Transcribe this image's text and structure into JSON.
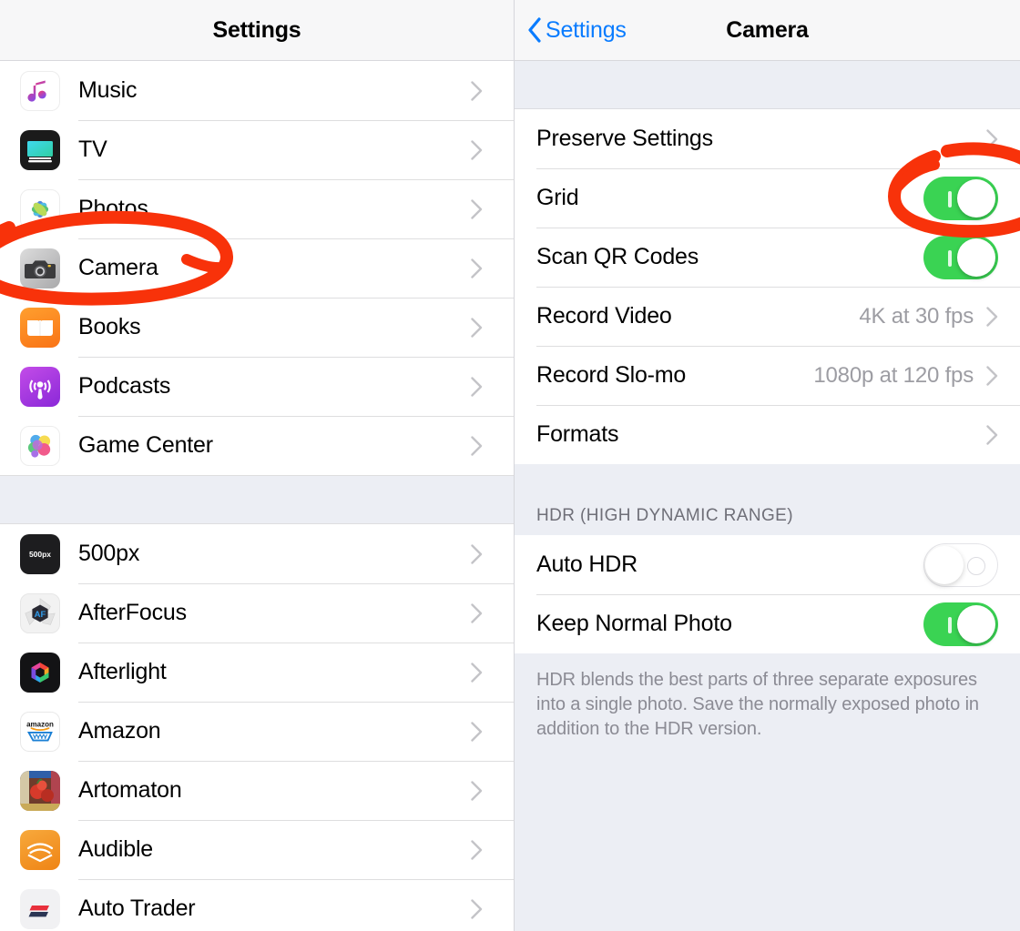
{
  "left": {
    "navbar": {
      "title": "Settings"
    },
    "groups": [
      {
        "items": [
          {
            "label": "Music",
            "icon": "music-app-icon"
          },
          {
            "label": "TV",
            "icon": "tv-app-icon"
          },
          {
            "label": "Photos",
            "icon": "photos-app-icon"
          },
          {
            "label": "Camera",
            "icon": "camera-app-icon"
          },
          {
            "label": "Books",
            "icon": "books-app-icon"
          },
          {
            "label": "Podcasts",
            "icon": "podcasts-app-icon"
          },
          {
            "label": "Game Center",
            "icon": "game-center-app-icon"
          }
        ]
      },
      {
        "items": [
          {
            "label": "500px",
            "icon": "500px-app-icon"
          },
          {
            "label": "AfterFocus",
            "icon": "afterfocus-app-icon"
          },
          {
            "label": "Afterlight",
            "icon": "afterlight-app-icon"
          },
          {
            "label": "Amazon",
            "icon": "amazon-app-icon"
          },
          {
            "label": "Artomaton",
            "icon": "artomaton-app-icon"
          },
          {
            "label": "Audible",
            "icon": "audible-app-icon"
          },
          {
            "label": "Auto Trader",
            "icon": "auto-trader-app-icon"
          }
        ]
      }
    ]
  },
  "right": {
    "navbar": {
      "back_label": "Settings",
      "title": "Camera"
    },
    "group1": [
      {
        "label": "Preserve Settings",
        "type": "disclosure",
        "value": ""
      },
      {
        "label": "Grid",
        "type": "toggle",
        "state": "on"
      },
      {
        "label": "Scan QR Codes",
        "type": "toggle",
        "state": "on"
      },
      {
        "label": "Record Video",
        "type": "disclosure",
        "value": "4K at 30 fps"
      },
      {
        "label": "Record Slo-mo",
        "type": "disclosure",
        "value": "1080p at 120 fps"
      },
      {
        "label": "Formats",
        "type": "disclosure",
        "value": ""
      }
    ],
    "hdr_section": {
      "header": "HDR (HIGH DYNAMIC RANGE)",
      "items": [
        {
          "label": "Auto HDR",
          "type": "toggle",
          "state": "off"
        },
        {
          "label": "Keep Normal Photo",
          "type": "toggle",
          "state": "on"
        }
      ],
      "footer": "HDR blends the best parts of three separate exposures into a single photo. Save the normally exposed photo in addition to the HDR version."
    }
  },
  "annotations": {
    "marker_color": "#f8320a",
    "circles": [
      {
        "name": "camera-row-highlight"
      },
      {
        "name": "grid-toggle-highlight"
      }
    ]
  },
  "colors": {
    "accent_blue": "#0a7cff",
    "toggle_on_green": "#3ad353",
    "group_background": "#eceef4",
    "separator": "#dededf",
    "secondary_text": "#9d9da3"
  }
}
